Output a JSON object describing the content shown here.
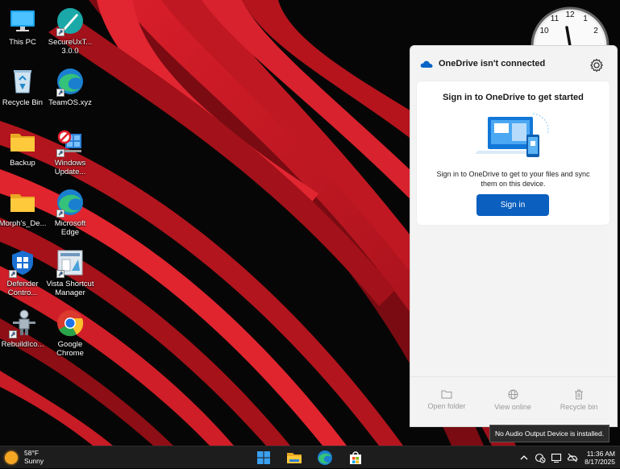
{
  "desktop": {
    "icons": [
      {
        "label": "This PC"
      },
      {
        "label": "SecureUxT... 3.0.0"
      },
      {
        "label": "Recycle Bin"
      },
      {
        "label": "TeamOS.xyz"
      },
      {
        "label": "Backup"
      },
      {
        "label": "Windows Update..."
      },
      {
        "label": "Morph's_De..."
      },
      {
        "label": "Microsoft Edge"
      },
      {
        "label": "Defender Contro..."
      },
      {
        "label": "Vista Shortcut Manager"
      },
      {
        "label": "RebuildIco..."
      },
      {
        "label": "Google Chrome"
      }
    ]
  },
  "clock_gadget": {
    "numerals": [
      "11",
      "12",
      "1",
      "2",
      "10"
    ]
  },
  "onedrive": {
    "title": "OneDrive isn't connected",
    "card_title": "Sign in to OneDrive to get started",
    "card_desc": "Sign in to OneDrive to get to your files and sync them on this device.",
    "signin_label": "Sign in",
    "footer": {
      "open_folder": "Open folder",
      "view_online": "View online",
      "recycle_bin": "Recycle bin"
    },
    "accent": "#0a5fbf"
  },
  "tooltip": {
    "text": "No Audio Output Device is installed."
  },
  "taskbar": {
    "weather": {
      "temp": "58°F",
      "condition": "Sunny"
    },
    "apps": [
      "windows-start-icon",
      "file-explorer-icon",
      "edge-icon",
      "microsoft-store-icon"
    ],
    "tray": {
      "time": "11:36 AM",
      "date": "8/17/2025"
    }
  }
}
